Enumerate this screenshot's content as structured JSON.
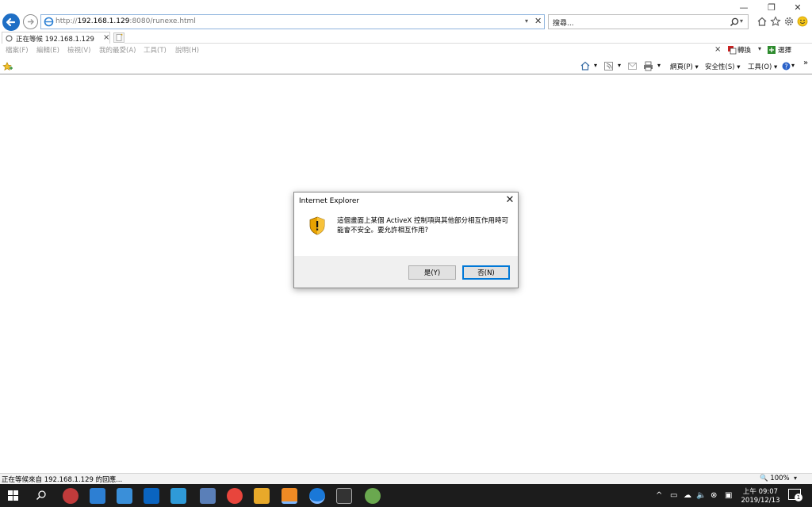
{
  "browser": {
    "address": {
      "scheme": "http://",
      "host": "192.168.1.129",
      "rest": ":8080/runexe.html"
    },
    "search_placeholder": "搜尋...",
    "tab": {
      "title": "正在等候 192.168.1.129",
      "close": "×"
    },
    "window_controls": {
      "minimize": "—",
      "restore": "❐",
      "close": "✕"
    }
  },
  "menubar": {
    "items": [
      "檔案(F)",
      "編輯(E)",
      "檢視(V)",
      "我的最愛(A)",
      "工具(T)",
      "說明(H)"
    ],
    "right": {
      "close": "×",
      "translate": "轉換",
      "select": "選擇"
    }
  },
  "commandbar": {
    "page": "網頁(P)",
    "safety": "安全性(S)",
    "tools": "工具(O)",
    "more": "»"
  },
  "dialog": {
    "title": "Internet Explorer",
    "close": "✕",
    "message": "這個畫面上某個 ActiveX 控制項與其他部分相互作用時可能會不安全。要允許相互作用?",
    "yes_label": "是(Y)",
    "no_label": "否(N)"
  },
  "statusbar": {
    "text": "正在等候來自 192.168.1.129 的回應...",
    "zoom": "🔍 100%",
    "zoom_arrow": "▾"
  },
  "taskbar": {
    "time": "上午 09:07",
    "date": "2019/12/13",
    "notification_count": "1"
  },
  "colors": {
    "accent": "#1f6fc5",
    "taskbar": "#1c1c1c",
    "dialog_footer": "#f0f0f0"
  }
}
